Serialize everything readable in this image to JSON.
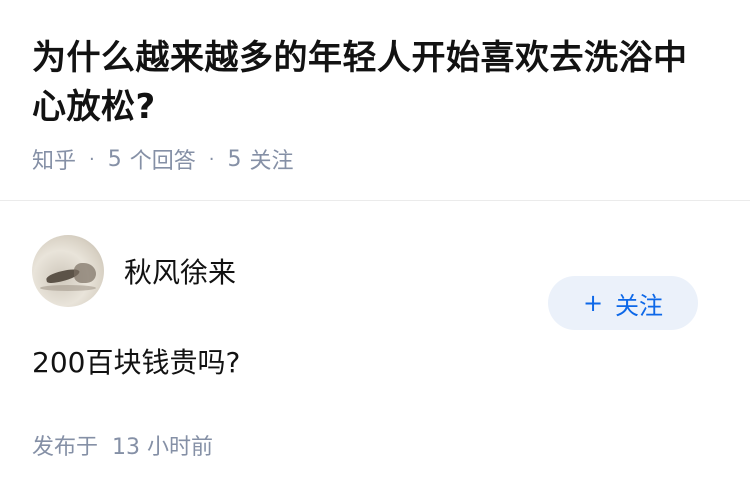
{
  "question": {
    "title": "为什么越来越多的年轻人开始喜欢去洗浴中心放松?",
    "source": "知乎",
    "answer_count": "5",
    "answer_label": "个回答",
    "follow_count": "5",
    "follow_label": "关注"
  },
  "answer": {
    "author_name": "秋风徐来",
    "follow_button": "关注",
    "content": "200百块钱贵吗?",
    "published_label": "发布于",
    "published_time": "13 小时前"
  },
  "colors": {
    "accent": "#0d68e8",
    "button_bg": "#ebf1fa",
    "meta_text": "#8590a6",
    "divider": "#ebebeb"
  }
}
